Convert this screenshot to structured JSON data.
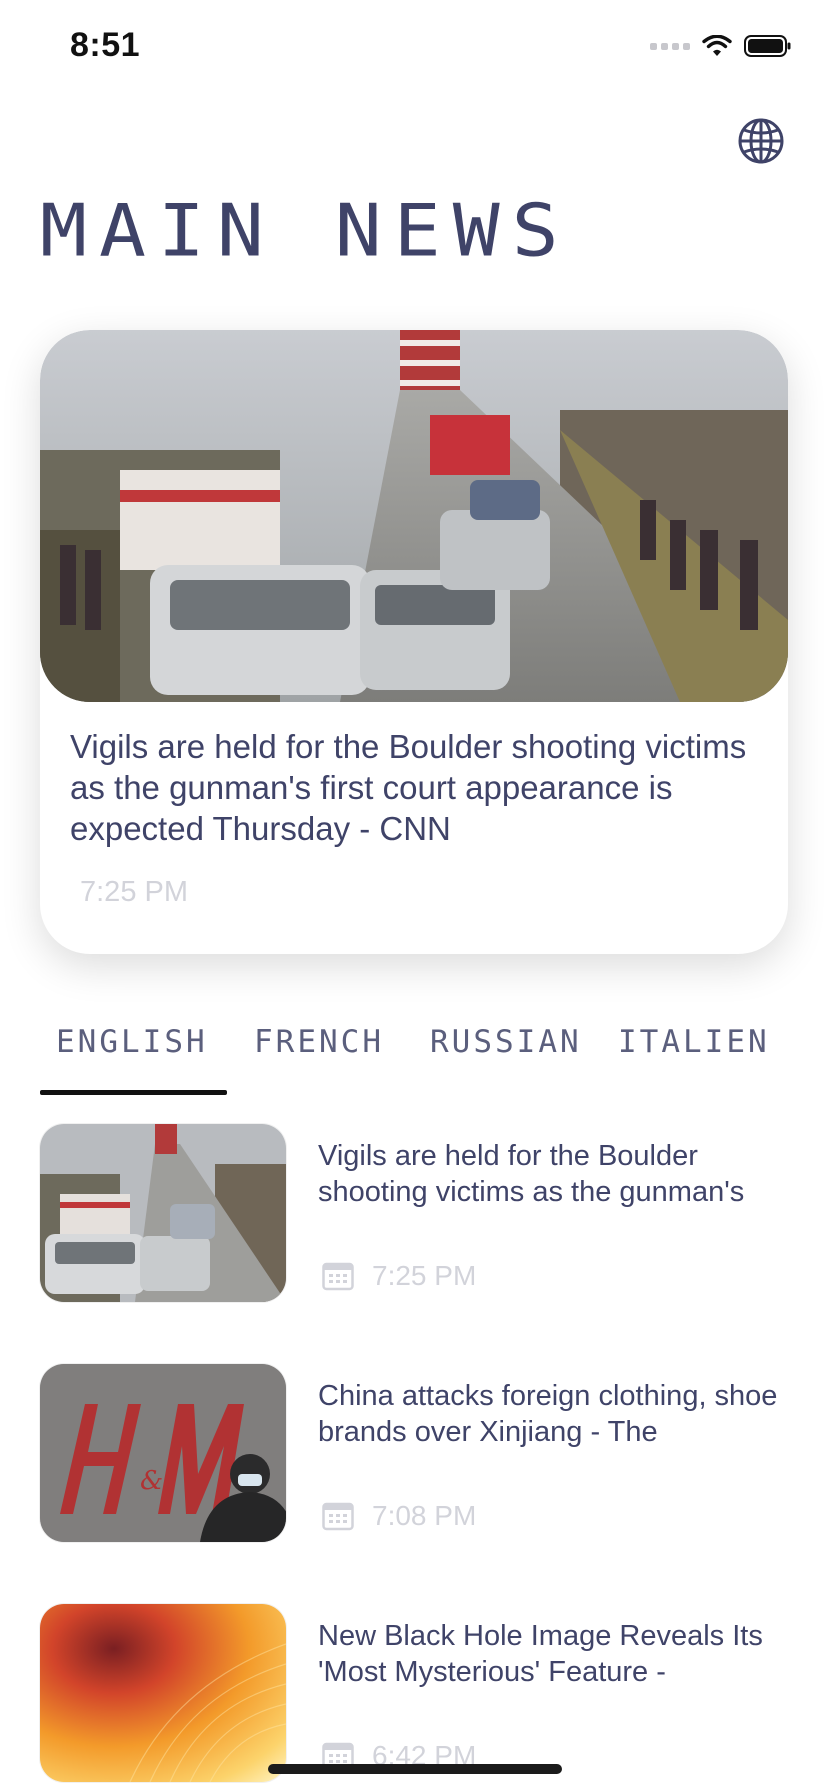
{
  "status_bar": {
    "time": "8:51"
  },
  "header": {
    "title": "MAIN NEWS",
    "globe_icon": "globe-icon"
  },
  "featured": {
    "title": "Vigils are held for the Boulder shooting victims as the gunman's first court appearance is expected Thursday - CNN",
    "time": "7:25 PM",
    "image": "motorcade-photo"
  },
  "tabs": [
    {
      "label": "ENGLISH",
      "selected": true
    },
    {
      "label": "FRENCH",
      "selected": false
    },
    {
      "label": "RUSSIAN",
      "selected": false
    },
    {
      "label": "ITALIEN",
      "selected": false
    }
  ],
  "articles": [
    {
      "title": "Vigils are held for the Boulder shooting victims as the gunman's",
      "time": "7:25 PM",
      "image": "motorcade-photo"
    },
    {
      "title": "China attacks foreign clothing, shoe brands over Xinjiang - The",
      "time": "7:08 PM",
      "image": "hm-store-photo"
    },
    {
      "title": "New Black Hole Image Reveals Its 'Most Mysterious' Feature -",
      "time": "6:42 PM",
      "image": "black-hole-image"
    }
  ],
  "colors": {
    "text": "#3f4368",
    "muted": "#d2d3da",
    "indicator": "#111111"
  }
}
